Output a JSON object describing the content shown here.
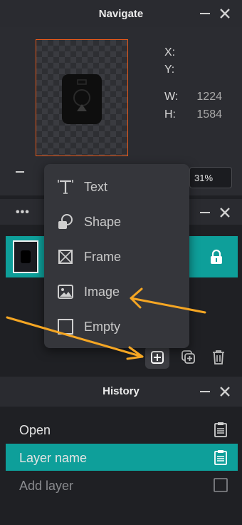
{
  "navigate": {
    "title": "Navigate",
    "x_label": "X:",
    "y_label": "Y:",
    "w_label": "W:",
    "w_value": "1224",
    "h_label": "H:",
    "h_value": "1584",
    "zoom": "31%"
  },
  "layers": {
    "menu_dots": "•••",
    "menu": [
      {
        "label": "Text",
        "icon": "text-icon"
      },
      {
        "label": "Shape",
        "icon": "shape-icon"
      },
      {
        "label": "Frame",
        "icon": "frame-icon"
      },
      {
        "label": "Image",
        "icon": "image-icon"
      },
      {
        "label": "Empty",
        "icon": "empty-icon"
      }
    ]
  },
  "history": {
    "title": "History",
    "items": [
      {
        "label": "Open"
      },
      {
        "label": "Layer name"
      },
      {
        "label": "Add layer"
      }
    ]
  },
  "colors": {
    "accent": "#0e9f9a",
    "selection_border": "#e8591a",
    "annotation_arrow": "#f5a623"
  }
}
